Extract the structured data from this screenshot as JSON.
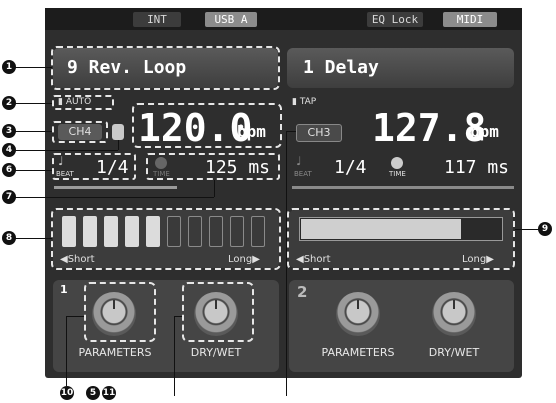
{
  "topbar": {
    "int": "INT",
    "usb": "USB A",
    "eq_lock": "EQ Lock",
    "midi": "MIDI"
  },
  "deck1": {
    "effect_name": "9 Rev. Loop",
    "auto": "AUTO",
    "channel": "CH4",
    "bpm_value": "120.0",
    "bpm_unit": "bpm",
    "beat_label": "BEAT",
    "beat_value": "1/4",
    "time_label": "TIME",
    "time_value": "125 ms",
    "time_bar_fraction": 0.55,
    "level_segments_on": 5,
    "level_segments_total": 10,
    "short": "Short",
    "long": "Long",
    "fx_number": "1",
    "knob1_label": "PARAMETERS",
    "knob2_label": "DRY/WET"
  },
  "deck2": {
    "effect_name": "1 Delay",
    "tap": "TAP",
    "channel": "CH3",
    "bpm_value": "127.8",
    "bpm_unit": "bpm",
    "beat_label": "BEAT",
    "beat_value": "1/4",
    "time_label": "TIME",
    "time_value": "117 ms",
    "bar_fraction": 0.8,
    "short": "Short",
    "long": "Long",
    "fx_number": "2",
    "knob1_label": "PARAMETERS",
    "knob2_label": "DRY/WET"
  },
  "callouts": [
    "1",
    "2",
    "3",
    "4",
    "6",
    "7",
    "8",
    "9",
    "10",
    "5",
    "11"
  ]
}
